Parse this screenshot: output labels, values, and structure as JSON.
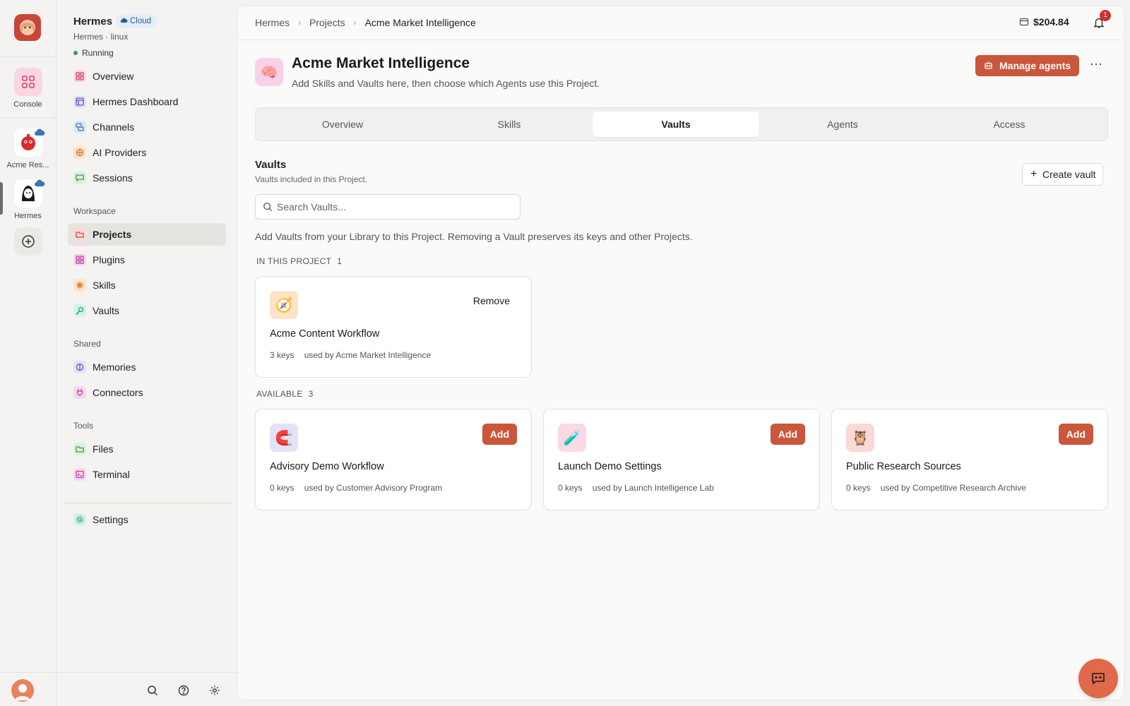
{
  "rail": {
    "console_label": "Console",
    "agents": [
      {
        "label": "Acme Res..."
      },
      {
        "label": "Hermes"
      }
    ]
  },
  "sidebar": {
    "name": "Hermes",
    "badge": "Cloud",
    "subtitle": "Hermes · linux",
    "status": "Running",
    "nav": [
      {
        "label": "Overview",
        "icon": "grid-icon"
      },
      {
        "label": "Hermes Dashboard",
        "icon": "dashboard-icon"
      },
      {
        "label": "Channels",
        "icon": "channels-icon"
      },
      {
        "label": "AI Providers",
        "icon": "ai-providers-icon"
      },
      {
        "label": "Sessions",
        "icon": "chat-bubble-icon"
      }
    ],
    "workspace_label": "Workspace",
    "workspace": [
      {
        "label": "Projects",
        "icon": "folder-icon"
      },
      {
        "label": "Plugins",
        "icon": "puzzle-icon"
      },
      {
        "label": "Skills",
        "icon": "sparkle-icon"
      },
      {
        "label": "Vaults",
        "icon": "key-icon"
      }
    ],
    "shared_label": "Shared",
    "shared": [
      {
        "label": "Memories",
        "icon": "brain-icon"
      },
      {
        "label": "Connectors",
        "icon": "plug-icon"
      }
    ],
    "tools_label": "Tools",
    "tools": [
      {
        "label": "Files",
        "icon": "file-folder-icon"
      },
      {
        "label": "Terminal",
        "icon": "terminal-icon"
      }
    ],
    "settings_label": "Settings"
  },
  "header": {
    "breadcrumbs": [
      "Hermes",
      "Projects",
      "Acme Market Intelligence"
    ],
    "balance": "$204.84",
    "notifications": "1"
  },
  "project": {
    "icon": "🧠",
    "title": "Acme Market Intelligence",
    "description": "Add Skills and Vaults here, then choose which Agents use this Project.",
    "manage_label": "Manage agents",
    "more_label": "···"
  },
  "tabs": [
    "Overview",
    "Skills",
    "Vaults",
    "Agents",
    "Access"
  ],
  "active_tab": "Vaults",
  "vaults": {
    "heading": "Vaults",
    "subheading": "Vaults included in this Project.",
    "create_label": "Create vault",
    "search_placeholder": "Search Vaults...",
    "help": "Add Vaults from your Library to this Project. Removing a Vault preserves its keys and other Projects.",
    "in_project_label": "IN THIS PROJECT",
    "in_project_count": "1",
    "in_project": [
      {
        "icon": "🧭",
        "icon_bg": "#fde3c8",
        "title": "Acme Content Workflow",
        "keys": "3 keys",
        "used_by": "used by Acme Market Intelligence",
        "action": "Remove"
      }
    ],
    "available_label": "AVAILABLE",
    "available_count": "3",
    "available": [
      {
        "icon": "🧲",
        "icon_bg": "#e3e2f7",
        "title": "Advisory Demo Workflow",
        "keys": "0 keys",
        "used_by": "used by Customer Advisory Program",
        "action": "Add"
      },
      {
        "icon": "🧪",
        "icon_bg": "#fbd9e4",
        "title": "Launch Demo Settings",
        "keys": "0 keys",
        "used_by": "used by Launch Intelligence Lab",
        "action": "Add"
      },
      {
        "icon": "🦉",
        "icon_bg": "#fbd9d6",
        "title": "Public Research Sources",
        "keys": "0 keys",
        "used_by": "used by Competitive Research Archive",
        "action": "Add"
      }
    ]
  },
  "colors": {
    "accent": "#c9573b",
    "fab": "#e0694a"
  }
}
